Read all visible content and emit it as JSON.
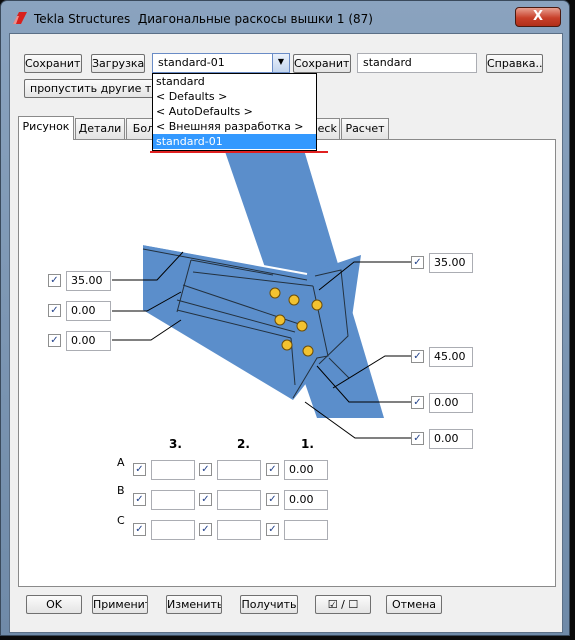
{
  "window": {
    "app_name": "Tekla Structures",
    "dialog_title": "Диагональные раскосы вышки 1 (87)",
    "close_symbol": "X"
  },
  "toolbar": {
    "save_label": "Сохранить",
    "load_label": "Загрузка",
    "preset_combo_value": "standard-01",
    "save_as_label": "Сохранить как",
    "save_as_name": "standard",
    "help_label": "Справка...",
    "skip_other_types_label": "пропустить другие типы"
  },
  "dropdown": {
    "items": [
      "standard",
      "< Defaults >",
      "< AutoDefaults >",
      "< Внешняя разработка >",
      "standard-01"
    ],
    "selected": "standard-01"
  },
  "tabs": [
    {
      "label": "Рисунок",
      "active": true
    },
    {
      "label": "Детали",
      "active": false
    },
    {
      "label": "Болты",
      "active": false
    },
    {
      "label": "Check",
      "active": false
    },
    {
      "label": "Расчет",
      "active": false
    }
  ],
  "picture": {
    "left_values": [
      "35.00",
      "0.00",
      "0.00"
    ],
    "right_values": [
      "35.00",
      "45.00",
      "0.00",
      "0.00"
    ],
    "grid_headers": [
      "3.",
      "2.",
      "1."
    ],
    "grid_rows": [
      {
        "label": "A",
        "values": [
          "",
          "",
          "0.00"
        ]
      },
      {
        "label": "B",
        "values": [
          "",
          "",
          "0.00"
        ]
      },
      {
        "label": "C",
        "values": [
          "",
          "",
          ""
        ]
      }
    ],
    "check_mark": "✓"
  },
  "footer": {
    "ok_label": "OK",
    "apply_label": "Применить",
    "modify_label": "Изменить",
    "get_label": "Получить",
    "toggle_label": "☑ / ☐",
    "cancel_label": "Отмена"
  },
  "colors": {
    "beam_blue": "#5b8ecb",
    "selection_blue": "#3399ff",
    "bolt_yellow": "#f2c230",
    "underline_red": "#e02020"
  }
}
